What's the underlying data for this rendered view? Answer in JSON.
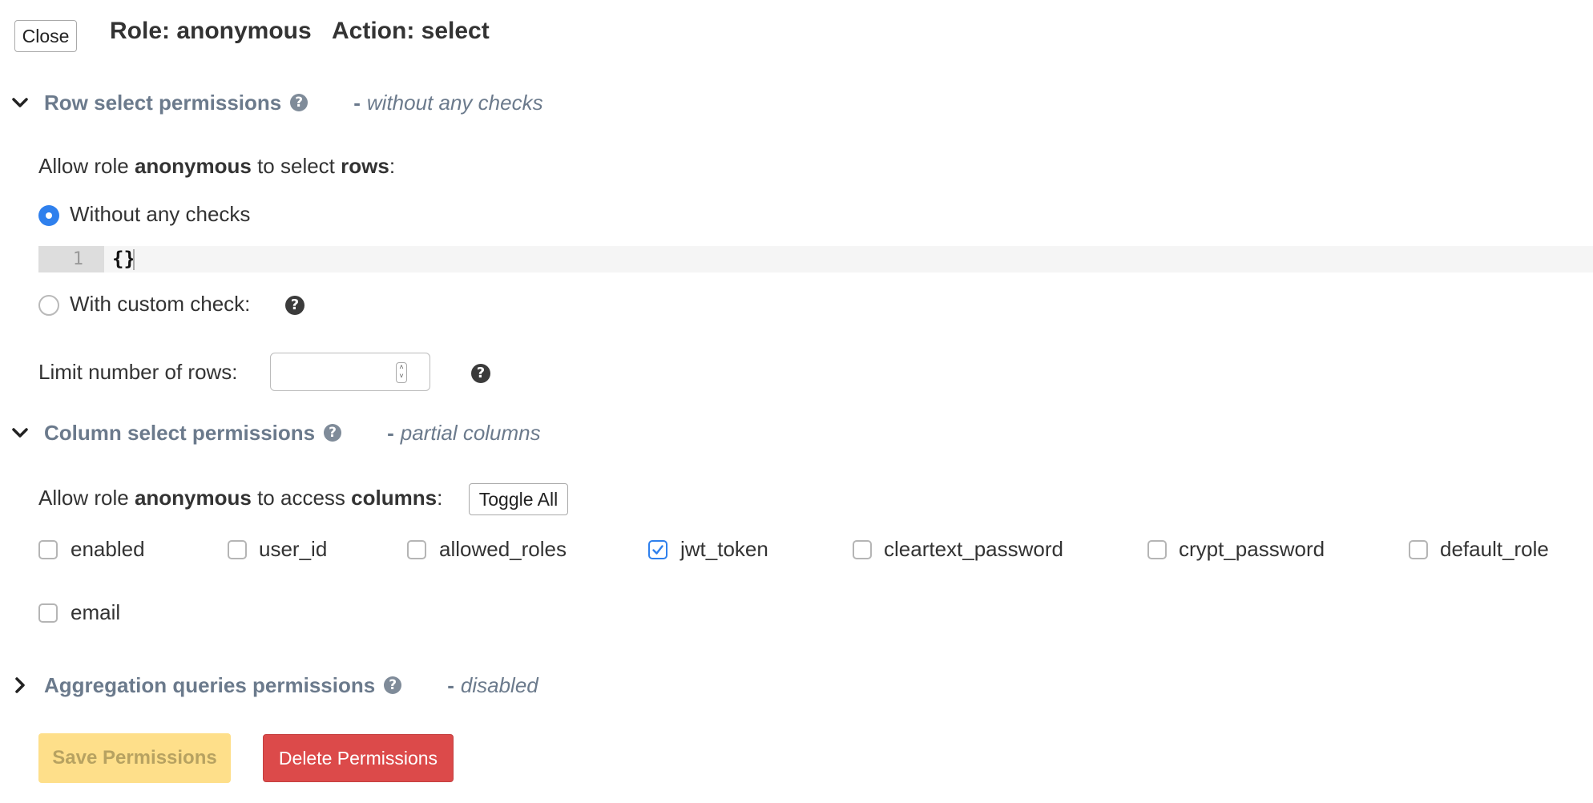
{
  "header": {
    "close_label": "Close",
    "role_text": "Role: anonymous",
    "action_text": "Action: select"
  },
  "row_section": {
    "title": "Row select permissions",
    "subtitle": "without any checks",
    "allow_prefix": "Allow role ",
    "role": "anonymous",
    "allow_middle": " to select ",
    "allow_object": "rows",
    "allow_suffix": ":",
    "option_without_checks": "Without any checks",
    "option_custom_check": "With custom check:",
    "editor_line_number": "1",
    "editor_code": "{}",
    "limit_label": "Limit number of rows:",
    "limit_value": "",
    "selected_option": "without_checks"
  },
  "column_section": {
    "title": "Column select permissions",
    "subtitle": "partial columns",
    "allow_prefix": "Allow role ",
    "role": "anonymous",
    "allow_middle": " to access ",
    "allow_object": "columns",
    "allow_suffix": ":",
    "toggle_all_label": "Toggle All",
    "columns": [
      {
        "name": "enabled",
        "checked": false
      },
      {
        "name": "user_id",
        "checked": false
      },
      {
        "name": "allowed_roles",
        "checked": false
      },
      {
        "name": "jwt_token",
        "checked": true
      },
      {
        "name": "cleartext_password",
        "checked": false
      },
      {
        "name": "crypt_password",
        "checked": false
      },
      {
        "name": "default_role",
        "checked": false
      },
      {
        "name": "email",
        "checked": false
      }
    ]
  },
  "aggregation_section": {
    "title": "Aggregation queries permissions",
    "subtitle": "disabled"
  },
  "actions": {
    "save_label": "Save Permissions",
    "delete_label": "Delete Permissions"
  },
  "colors": {
    "accent_blue": "#2f80ed",
    "section_title": "#6b7a8c",
    "save_bg": "#fedf8a",
    "delete_bg": "#dc4a4a"
  }
}
